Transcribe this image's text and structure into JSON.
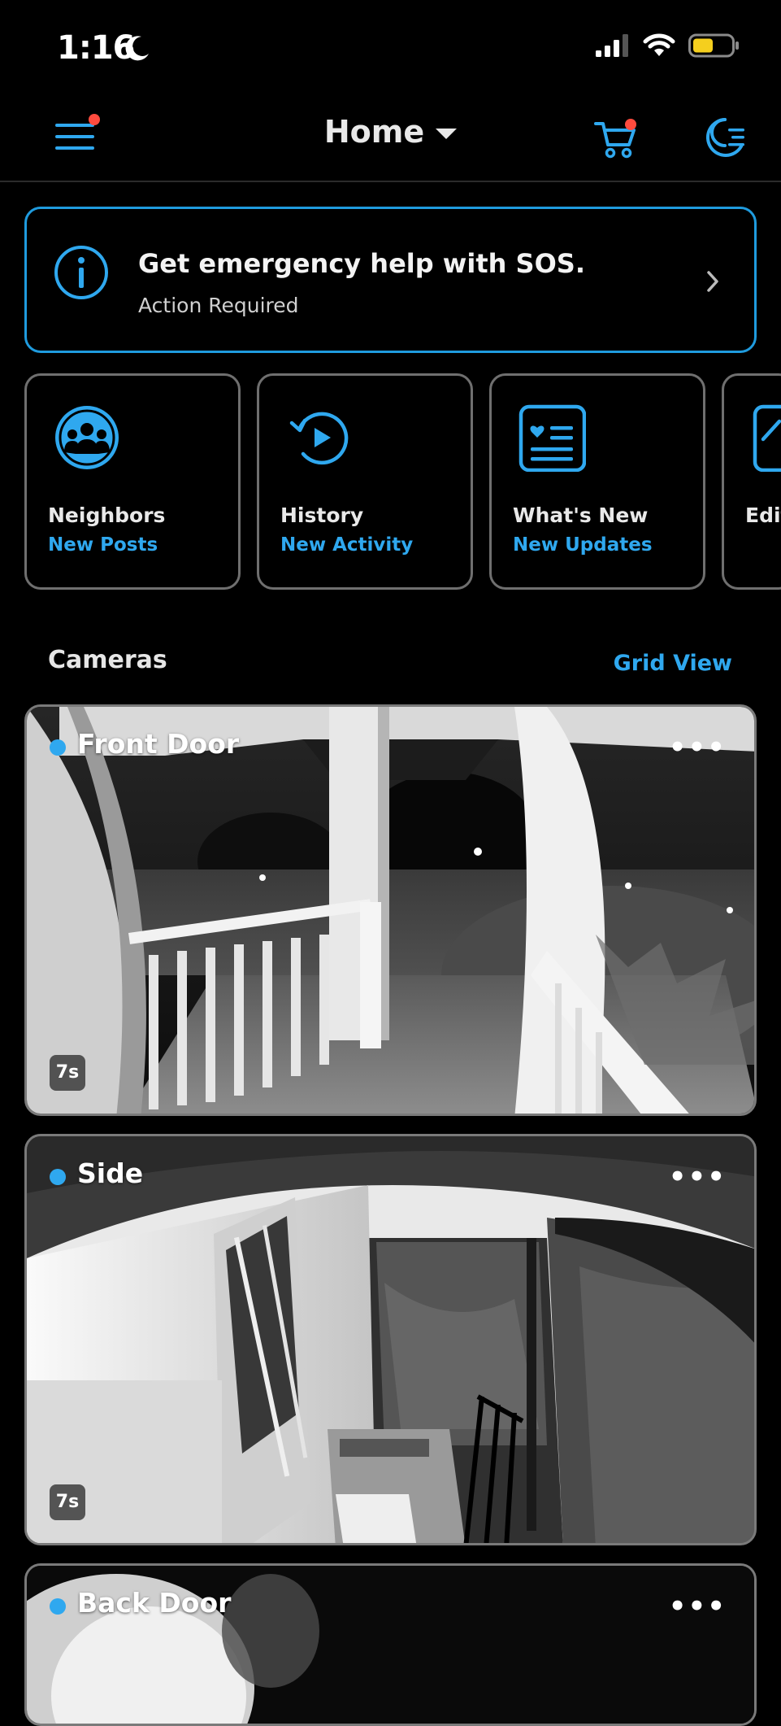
{
  "status_bar": {
    "time": "1:16"
  },
  "header": {
    "location": "Home"
  },
  "sos_banner": {
    "title": "Get emergency help with SOS.",
    "subtitle": "Action Required"
  },
  "quick_cards": [
    {
      "title": "Neighbors",
      "subtitle": "New Posts"
    },
    {
      "title": "History",
      "subtitle": "New Activity"
    },
    {
      "title": "What's New",
      "subtitle": "New Updates"
    },
    {
      "title": "Edit",
      "subtitle": ""
    }
  ],
  "cameras": {
    "label": "Cameras",
    "view_toggle": "Grid View",
    "items": [
      {
        "name": "Front Door",
        "duration": "7s"
      },
      {
        "name": "Side",
        "duration": "7s"
      },
      {
        "name": "Back Door",
        "duration": ""
      }
    ]
  },
  "colors": {
    "accent": "#2fa8ef",
    "alert_dot": "#ff4b3e",
    "battery": "#f5cf1e"
  }
}
